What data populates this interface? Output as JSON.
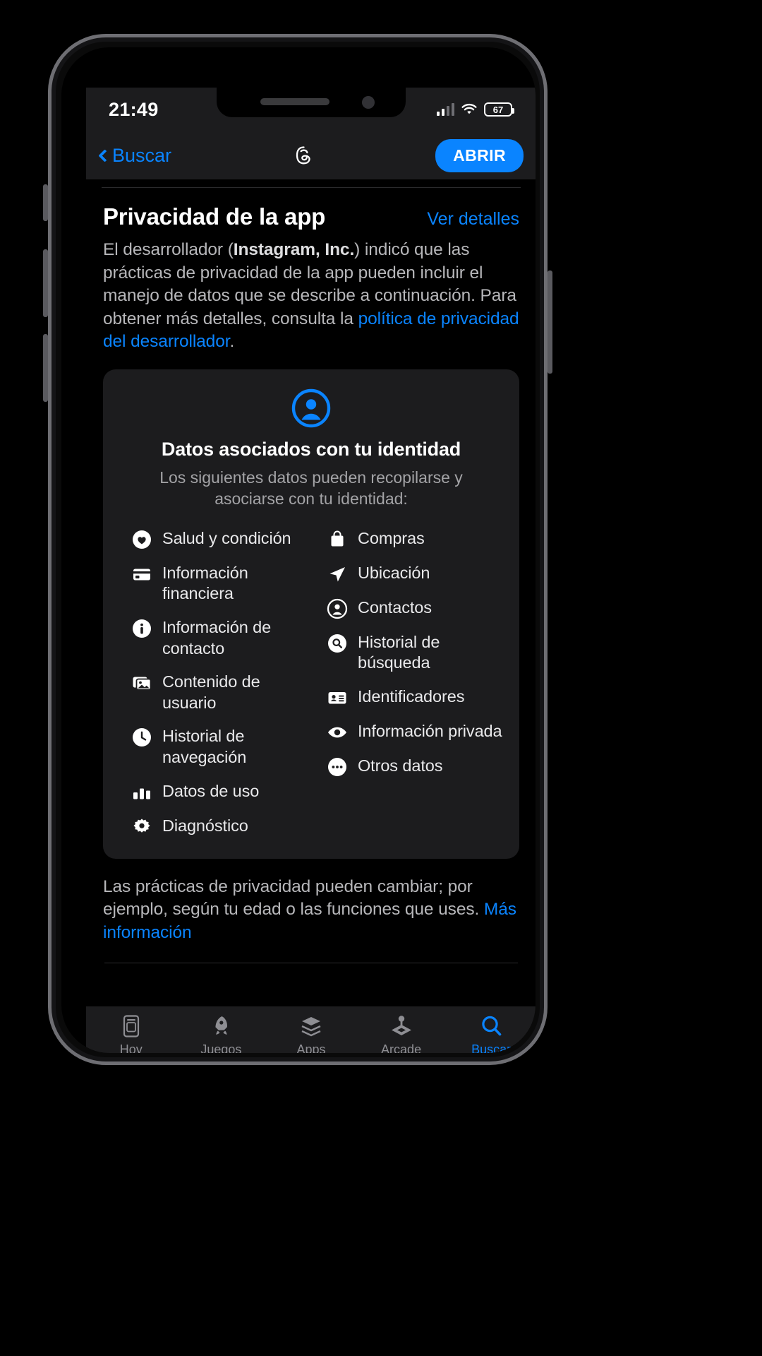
{
  "status_bar": {
    "time": "21:49",
    "battery_level": "67",
    "signal_icon": "cellular-signal-icon",
    "wifi_icon": "wifi-icon",
    "battery_icon": "battery-icon"
  },
  "nav_bar": {
    "back_label": "Buscar",
    "back_icon": "chevron-left-icon",
    "app_icon": "threads-logo-icon",
    "open_button": "ABRIR"
  },
  "section": {
    "title": "Privacidad de la app",
    "details_link": "Ver detalles",
    "intro_prefix": "El desarrollador (",
    "intro_developer": "Instagram, Inc.",
    "intro_middle": ") indicó que las prácticas de privacidad de la app pueden incluir el manejo de datos que se describe a continuación. Para obtener más detalles, consulta la ",
    "intro_link": "política de privacidad del desarrollador",
    "intro_suffix": "."
  },
  "card": {
    "icon": "person-circle-icon",
    "title": "Datos asociados con tu identidad",
    "subtitle": "Los siguientes datos pueden recopilarse y asociarse con tu identidad:",
    "left_column": [
      {
        "icon": "heart-circle-icon",
        "label": "Salud y condición"
      },
      {
        "icon": "credit-card-icon",
        "label": "Información financiera"
      },
      {
        "icon": "info-circle-icon",
        "label": "Información de contacto"
      },
      {
        "icon": "photo-stack-icon",
        "label": "Contenido de usuario"
      },
      {
        "icon": "clock-icon",
        "label": "Historial de navegación"
      },
      {
        "icon": "bar-chart-icon",
        "label": "Datos de uso"
      },
      {
        "icon": "gear-icon",
        "label": "Diagnóstico"
      }
    ],
    "right_column": [
      {
        "icon": "shopping-bag-icon",
        "label": "Compras"
      },
      {
        "icon": "location-arrow-icon",
        "label": "Ubicación"
      },
      {
        "icon": "person-circle-icon",
        "label": "Contactos"
      },
      {
        "icon": "magnifier-circle-icon",
        "label": "Historial de búsqueda"
      },
      {
        "icon": "id-card-icon",
        "label": "Identificadores"
      },
      {
        "icon": "eye-icon",
        "label": "Información privada"
      },
      {
        "icon": "ellipsis-circle-icon",
        "label": "Otros datos"
      }
    ]
  },
  "footer": {
    "text": "Las prácticas de privacidad pueden cambiar; por ejemplo, según tu edad o las funciones que uses. ",
    "link": "Más información"
  },
  "tab_bar": {
    "tabs": [
      {
        "label": "Hoy",
        "icon": "today-icon",
        "active": false
      },
      {
        "label": "Juegos",
        "icon": "rocket-icon",
        "active": false
      },
      {
        "label": "Apps",
        "icon": "app-stack-icon",
        "active": false
      },
      {
        "label": "Arcade",
        "icon": "arcade-joystick-icon",
        "active": false
      },
      {
        "label": "Buscar",
        "icon": "search-icon",
        "active": true
      }
    ]
  },
  "colors": {
    "accent": "#0a84ff",
    "card_bg": "#1c1c1e",
    "text_primary": "#ffffff",
    "text_secondary": "#b7b7ba"
  }
}
